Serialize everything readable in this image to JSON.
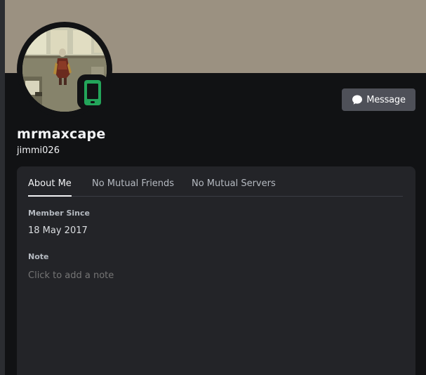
{
  "profile": {
    "display_name": "mrmaxcape",
    "username": "jimmi026",
    "status": "online-mobile",
    "status_color": "#23a55a",
    "banner_color": "#9b9181"
  },
  "actions": {
    "message_label": "Message",
    "message_icon": "chat-bubble-icon"
  },
  "tabs": [
    {
      "label": "About Me",
      "active": true
    },
    {
      "label": "No Mutual Friends",
      "active": false
    },
    {
      "label": "No Mutual Servers",
      "active": false
    }
  ],
  "about": {
    "member_since_title": "Member Since",
    "member_since_value": "18 May 2017",
    "note_title": "Note",
    "note_placeholder": "Click to add a note"
  },
  "colors": {
    "background": "#111214",
    "panel": "#232428",
    "button": "#4e5058",
    "accent_green": "#23a55a"
  }
}
